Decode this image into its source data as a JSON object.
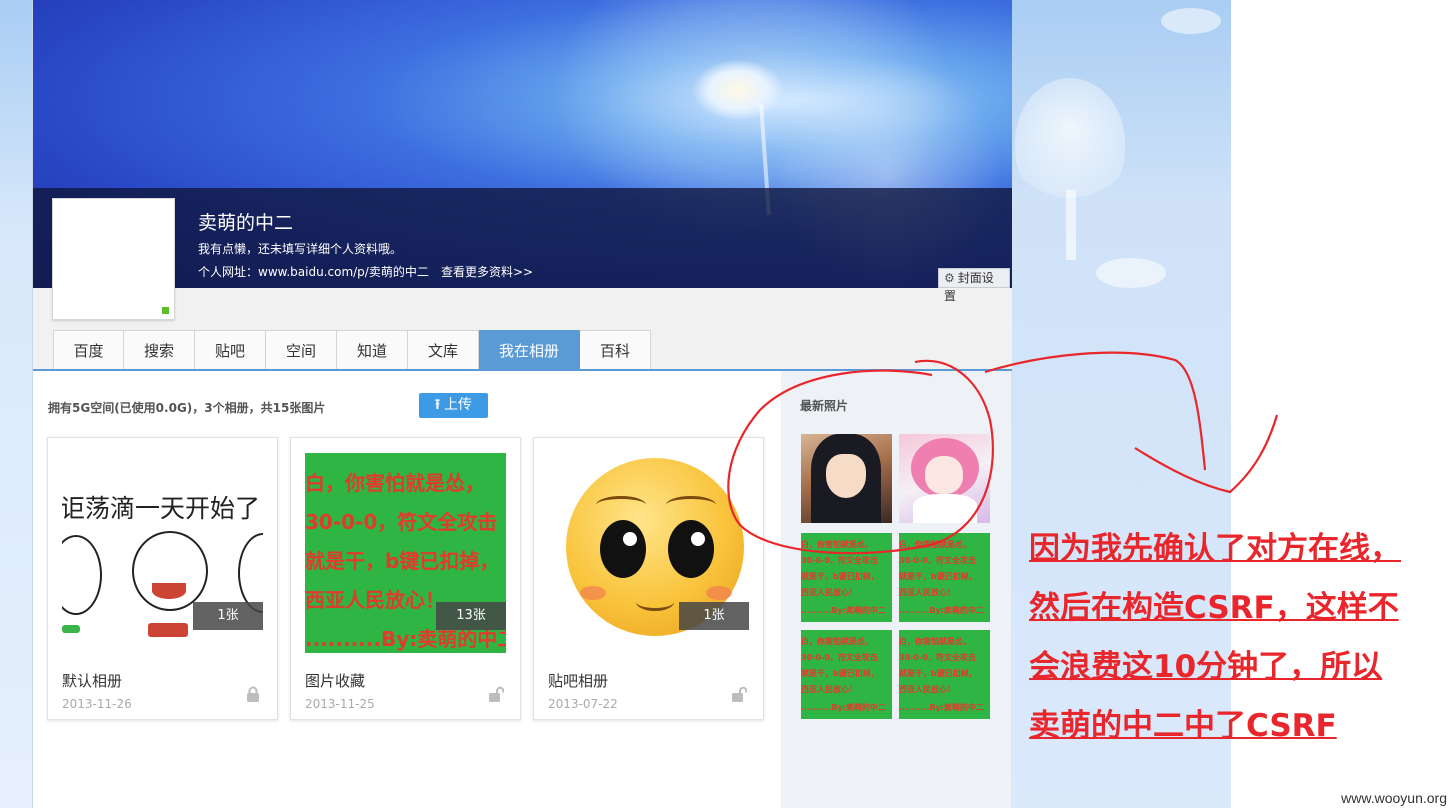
{
  "profile": {
    "name": "卖萌的中二",
    "motto": "我有点懒，还未填写详细个人资料哦。",
    "url": "个人网址：www.baidu.com/p/卖萌的中二",
    "more_link": "查看更多资料>>",
    "cover_settings": "封面设置"
  },
  "tabs": [
    {
      "label": "百度",
      "active": false
    },
    {
      "label": "搜索",
      "active": false
    },
    {
      "label": "贴吧",
      "active": false
    },
    {
      "label": "空间",
      "active": false
    },
    {
      "label": "知道",
      "active": false
    },
    {
      "label": "文库",
      "active": false
    },
    {
      "label": "我在相册",
      "active": true
    },
    {
      "label": "百科",
      "active": false
    }
  ],
  "summary": "拥有5G空间(已使用0.0G)，3个相册，共15张图片",
  "upload_label": "上传",
  "albums": [
    {
      "name": "默认相册",
      "date": "2013-11-26",
      "count": "1张",
      "thumb_text": "讵荡滴一天开始了",
      "locked": true
    },
    {
      "name": "图片收藏",
      "date": "2013-11-25",
      "count": "13张",
      "locked": false,
      "thumb_lines": [
        "白，你害怕就是怂，",
        "30-0-0，符文全攻击",
        "就是干，b键已扣掉，",
        "西亚人民放心！",
        "..........By:卖萌的中二"
      ]
    },
    {
      "name": "贴吧相册",
      "date": "2013-07-22",
      "count": "1张",
      "locked": false
    }
  ],
  "sidebar": {
    "title": "最新照片",
    "mini_lines": [
      "白，你害怕就是怂，",
      "30-0-0，符文全攻击",
      "就是干，b键已扣掉，",
      "西亚人民放心！",
      "..........By:卖萌的中二"
    ]
  },
  "annotation": {
    "lines": [
      "因为我先确认了对方在线，",
      "然后在构造CSRF，这样不",
      "会浪费这10分钟了，所以",
      "卖萌的中二中了CSRF"
    ],
    "color": "#e8262b"
  },
  "watermark": "www.wooyun.org",
  "colors": {
    "tab_active": "#5b9bd5",
    "upload": "#3d9be5",
    "online": "#5cc02a"
  }
}
